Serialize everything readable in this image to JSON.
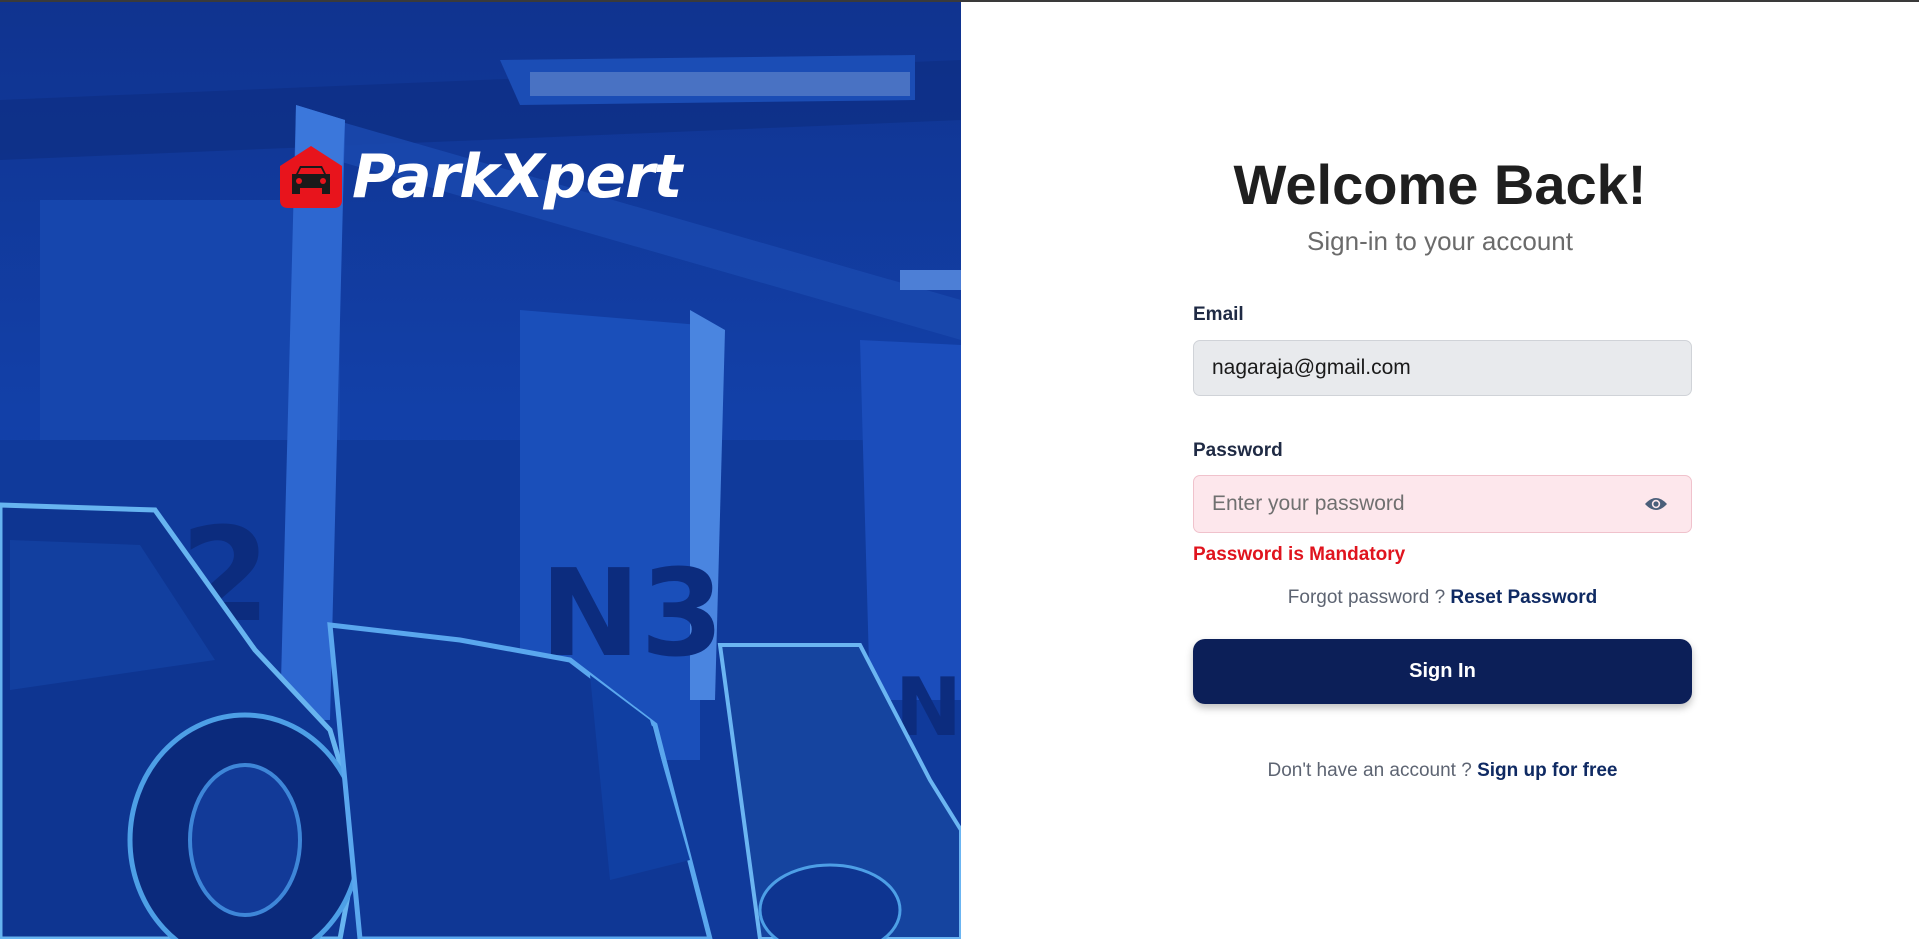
{
  "brand": {
    "name": "ParkXpert",
    "logo_icon": "car-house-icon",
    "logo_color": "#e8141c"
  },
  "header": {
    "title": "Welcome Back!",
    "subtitle": "Sign-in to your account"
  },
  "form": {
    "email_label": "Email",
    "email_value": "nagaraja@gmail.com",
    "password_label": "Password",
    "password_placeholder": "Enter your password",
    "password_value": "",
    "password_toggle_icon": "eye-icon",
    "password_error": "Password is Mandatory",
    "forgot_text": "Forgot password ?",
    "reset_link": "Reset Password",
    "signin_label": "Sign In",
    "signup_text": "Don't have an account ?",
    "signup_link": "Sign up for free"
  },
  "colors": {
    "primary": "#0c1f58",
    "error": "#e0141e",
    "link": "#0f2a63",
    "hero_bg": "#1346b4"
  }
}
